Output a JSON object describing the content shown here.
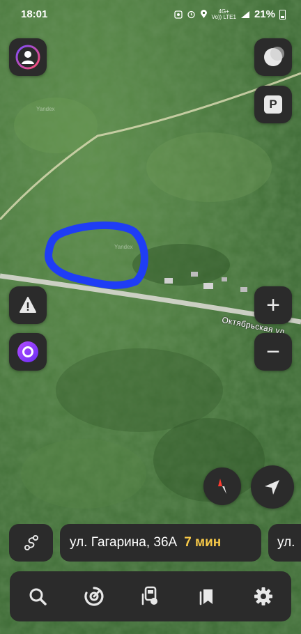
{
  "status_bar": {
    "time": "18:01",
    "network_top": "Vo)) LTE1",
    "network_bottom": "4G+",
    "battery": "21%"
  },
  "map": {
    "street_label": "Октябрьская ул.",
    "watermark": "Yandex",
    "highlight_color": "#1f3df5",
    "road_color": "#d8d8b8"
  },
  "buttons": {
    "profile": "avatar-icon",
    "theme": "moon-icon",
    "parking": "P",
    "alert": "warning-icon",
    "alice": "alice-icon",
    "zoom_in": "+",
    "zoom_out": "−",
    "compass": "compass-icon",
    "locate": "locate-arrow-icon"
  },
  "route": {
    "address": "ул. Гагарина, 36А",
    "eta": "7 мин",
    "next_address": "ул."
  },
  "tabbar": {
    "items": [
      "search-icon",
      "navigator-icon",
      "transport-icon",
      "bookmarks-icon",
      "settings-icon"
    ]
  }
}
